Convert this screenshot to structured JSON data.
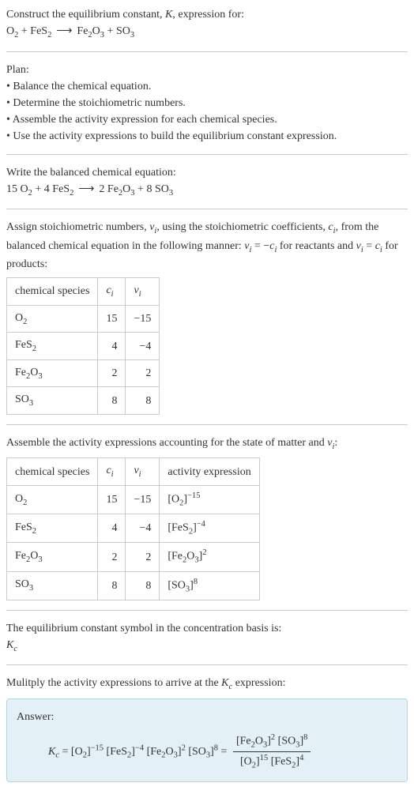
{
  "header": {
    "line1_prefix": "Construct the equilibrium constant, ",
    "line1_K": "K",
    "line1_suffix": ", expression for:",
    "eq_O2": "O",
    "eq_FeS2": "FeS",
    "eq_Fe2O3_Fe": "Fe",
    "eq_Fe2O3_O": "O",
    "eq_SO3_S": "SO",
    "sub2": "2",
    "sub3": "3",
    "plus": " + ",
    "arrow": "⟶"
  },
  "plan": {
    "title": "Plan:",
    "b1": "• Balance the chemical equation.",
    "b2": "• Determine the stoichiometric numbers.",
    "b3": "• Assemble the activity expression for each chemical species.",
    "b4": "• Use the activity expressions to build the equilibrium constant expression."
  },
  "balanced": {
    "intro": "Write the balanced chemical equation:",
    "c15": "15 ",
    "c4": "4 ",
    "c2": "2 ",
    "c8": "8 "
  },
  "stoich_text": {
    "part1": "Assign stoichiometric numbers, ",
    "nu": "ν",
    "sub_i": "i",
    "part2": ", using the stoichiometric coefficients, ",
    "c": "c",
    "part3": ", from the balanced chemical equation in the following manner: ",
    "eq1_lhs": "ν",
    "eq1_mid": " = −",
    "part4": " for reactants and ",
    "eq2_mid": " = ",
    "part5": " for products:"
  },
  "table1": {
    "h1": "chemical species",
    "h2": "c",
    "h2sub": "i",
    "h3": "ν",
    "h3sub": "i",
    "rows": [
      {
        "sp_a": "O",
        "sp_sub": "2",
        "sp_b": "",
        "c": "15",
        "nu": "−15"
      },
      {
        "sp_a": "FeS",
        "sp_sub": "2",
        "sp_b": "",
        "c": "4",
        "nu": "−4"
      },
      {
        "sp_a": "Fe",
        "sp_mid_sub": "2",
        "sp_b": "O",
        "sp_sub": "3",
        "c": "2",
        "nu": "2"
      },
      {
        "sp_a": "SO",
        "sp_sub": "3",
        "sp_b": "",
        "c": "8",
        "nu": "8"
      }
    ]
  },
  "activity_intro": {
    "part1": "Assemble the activity expressions accounting for the state of matter and ",
    "nu": "ν",
    "sub_i": "i",
    "colon": ":"
  },
  "table2": {
    "h1": "chemical species",
    "h2": "c",
    "h2sub": "i",
    "h3": "ν",
    "h3sub": "i",
    "h4": "activity expression",
    "rows": [
      {
        "c": "15",
        "nu": "−15",
        "exp": "−15"
      },
      {
        "c": "4",
        "nu": "−4",
        "exp": "−4"
      },
      {
        "c": "2",
        "nu": "2",
        "exp": "2"
      },
      {
        "c": "8",
        "nu": "8",
        "exp": "8"
      }
    ]
  },
  "kc_symbol": {
    "line1": "The equilibrium constant symbol in the concentration basis is:",
    "K": "K",
    "sub_c": "c"
  },
  "multiply": {
    "part1": "Mulitply the activity expressions to arrive at the ",
    "K": "K",
    "sub_c": "c",
    "part2": " expression:"
  },
  "answer": {
    "label": "Answer:",
    "K": "K",
    "sub_c": "c",
    "eq": " = ",
    "exp_n15": "−15",
    "exp_n4": "−4",
    "exp_2": "2",
    "exp_8": "8",
    "exp_15": "15",
    "exp_4": "4"
  }
}
